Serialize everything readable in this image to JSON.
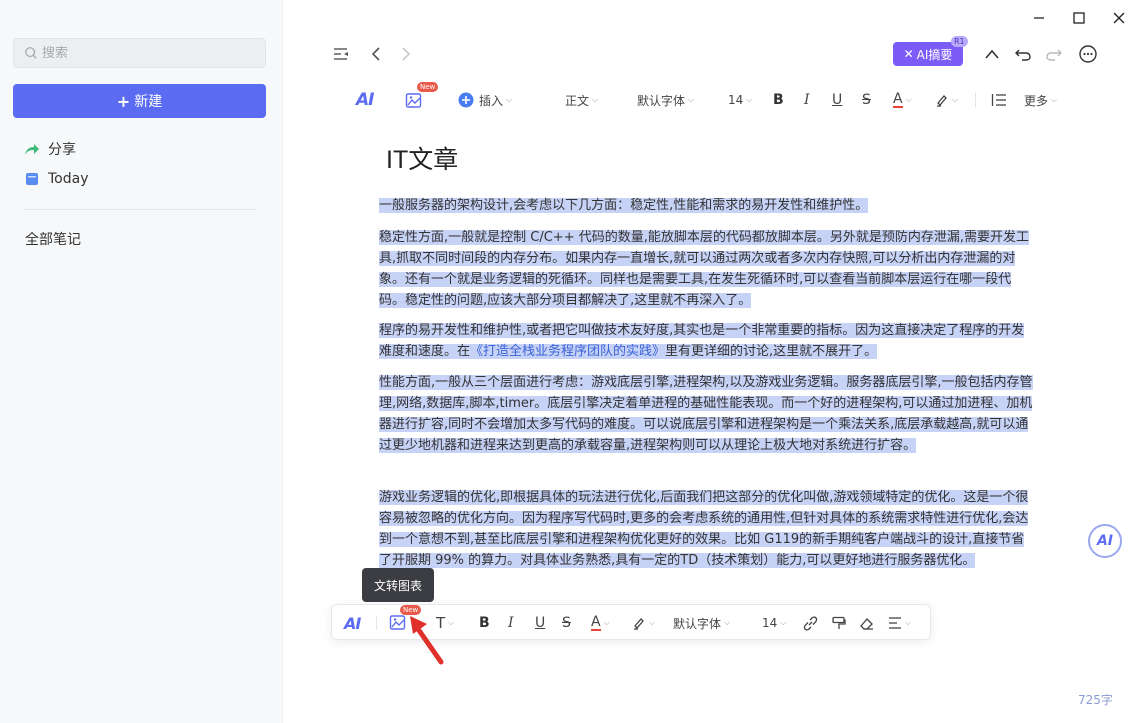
{
  "sidebar": {
    "search_placeholder": "搜索",
    "new_label": "新建",
    "items": [
      {
        "label": "分享",
        "icon": "share-arrow-icon"
      },
      {
        "label": "Today",
        "icon": "notebook-icon"
      }
    ],
    "all_notes": "全部笔记"
  },
  "toolbar": {
    "ai_summary": "AI摘要",
    "r1_badge": "R1",
    "insert": "插入",
    "style": "正文",
    "font": "默认字体",
    "size": "14",
    "more": "更多",
    "new_badge": "New",
    "ai_text": "AI",
    "bold": "B",
    "italic": "I",
    "underline": "U",
    "strike": "S",
    "color": "A"
  },
  "article": {
    "title": "IT文章",
    "paragraphs": [
      "一般服务器的架构设计,会考虑以下几方面：稳定性,性能和需求的易开发性和维护性。",
      "稳定性方面,一般就是控制 C/C++ 代码的数量,能放脚本层的代码都放脚本层。另外就是预防内存泄漏,需要开发工具,抓取不同时间段的内存分布。如果内存一直增长,就可以通过两次或者多次内存快照,可以分析出内存泄漏的对象。还有一个就是业务逻辑的死循环。同样也是需要工具,在发生死循环时,可以查看当前脚本层运行在哪一段代码。稳定性的问题,应该大部分项目都解决了,这里就不再深入了。",
      "程序的易开发性和维护性,或者把它叫做技术友好度,其实也是一个非常重要的指标。因为这直接决定了程序的开发难度和速度。在",
      "《打造全栈业务程序团队的实践》",
      "里有更详细的讨论,这里就不展开了。",
      "性能方面,一般从三个层面进行考虑：游戏底层引擎,进程架构,以及游戏业务逻辑。服务器底层引擎,一般包括内存管理,网络,数据库,脚本,timer。底层引擎决定着单进程的基础性能表现。而一个好的进程架构,可以通过加进程、加机器进行扩容,同时不会增加太多写代码的难度。可以说底层引擎和进程架构是一个乘法关系,底层承载越高,就可以通过更少地机器和进程来达到更高的承载容量,进程架构则可以从理论上极大地对系统进行扩容。",
      "游戏业务逻辑的优化,即根据具体的玩法进行优化,后面我们把这部分的优化叫做,游戏领域特定的优化。这是一个很容易被忽略的优化方向。因为程序写代码时,更多的会考虑系统的通用性,但针对具体的系统需求特性进行优化,会达到一个意想不到,甚至比底层引擎和进程架构优化更好的效果。比如 G119的新手期纯客户端战斗的设计,直接节省了开服期 99% 的算力。对具体业务熟悉,具有一定的TD（技术策划）能力,可以更",
      "好地进行服务器优化。"
    ]
  },
  "tooltip": "文转图表",
  "floatbar": {
    "font": "默认字体",
    "size": "14",
    "heading": "T",
    "new_badge": "New"
  },
  "ai_float": "AI",
  "word_count": "725字"
}
